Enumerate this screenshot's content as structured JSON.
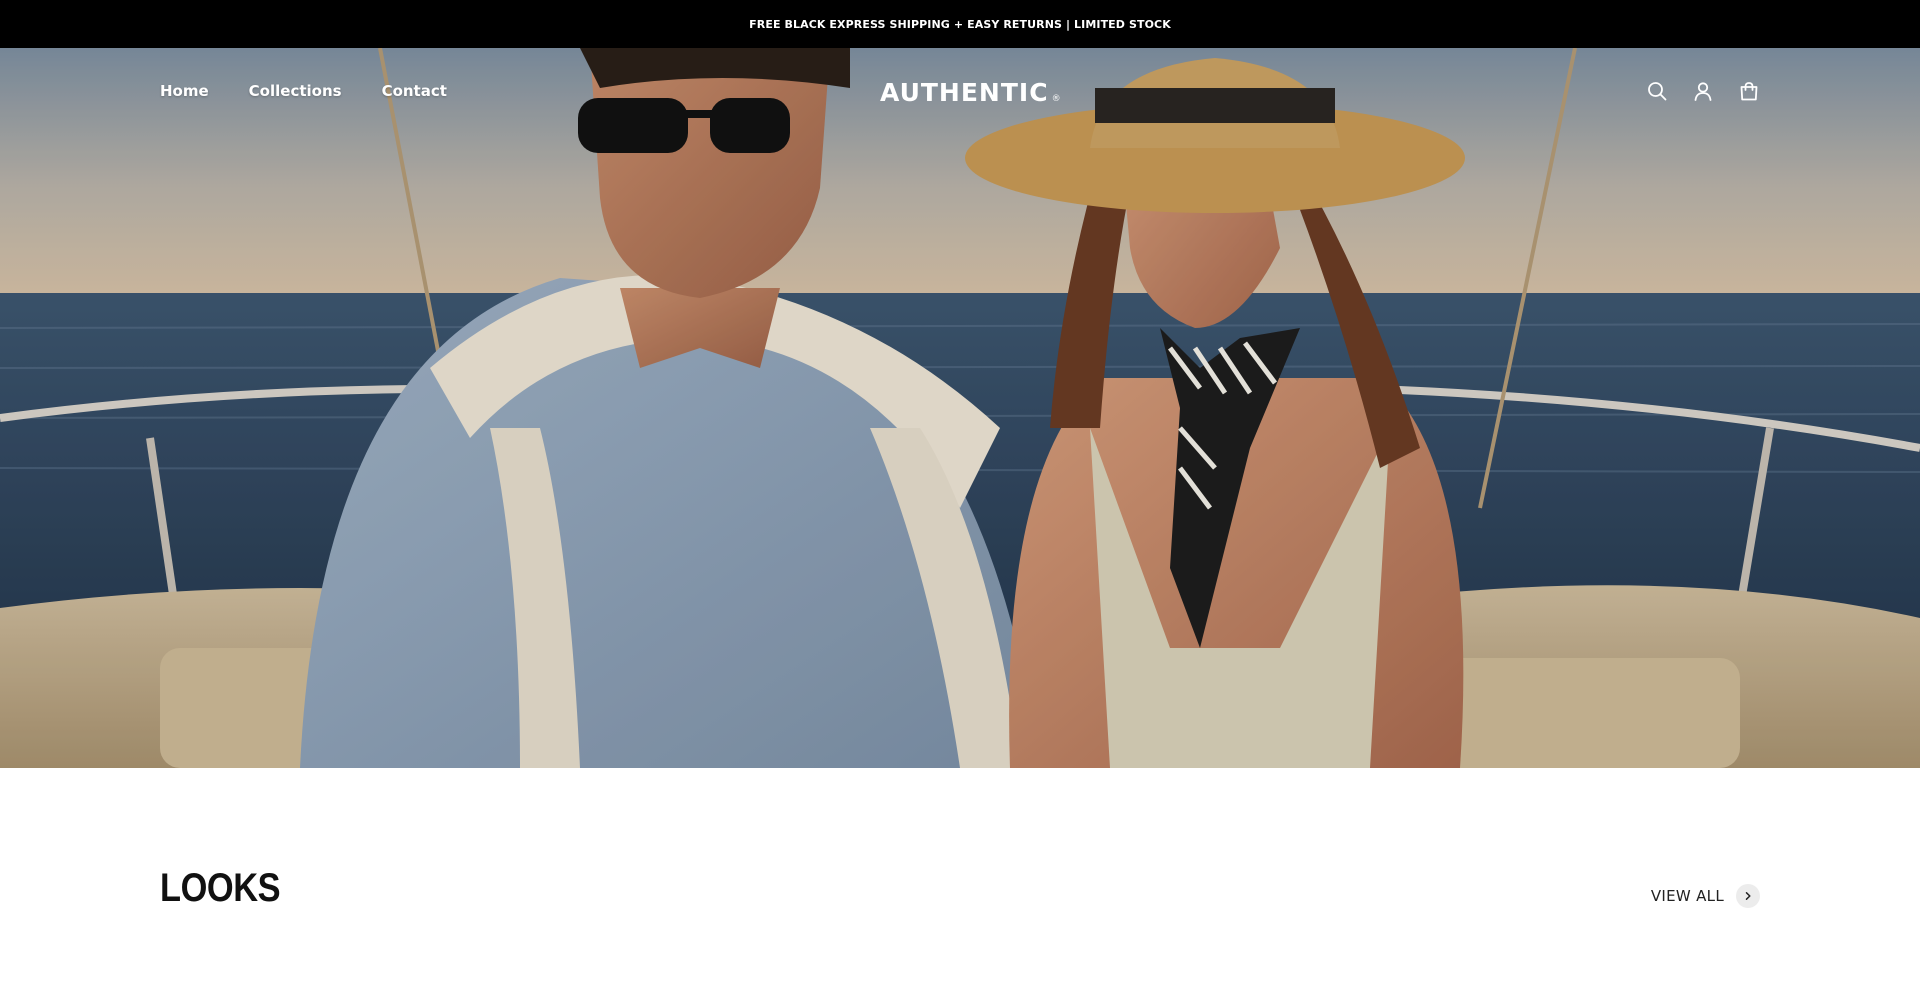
{
  "announcement": {
    "text": "FREE BLACK EXPRESS SHIPPING + EASY RETURNS | LIMITED STOCK"
  },
  "header": {
    "nav": [
      {
        "label": "Home"
      },
      {
        "label": "Collections"
      },
      {
        "label": "Contact"
      }
    ],
    "logo": {
      "text": "AUTHENTIC",
      "mark": "®"
    },
    "icons": [
      "search-icon",
      "account-icon",
      "cart-icon"
    ]
  },
  "hero": {
    "image": "couple-on-boat-at-sea"
  },
  "looks": {
    "title": "LOOKS",
    "view_all_label": "VIEW ALL",
    "arrow_icon": "chevron-right-icon"
  },
  "colors": {
    "announcement_bg": "#000000",
    "announcement_text": "#ffffff",
    "header_text": "#ffffff",
    "page_bg": "#ffffff",
    "heading_text": "#111111",
    "arrow_bg": "#ececec"
  }
}
